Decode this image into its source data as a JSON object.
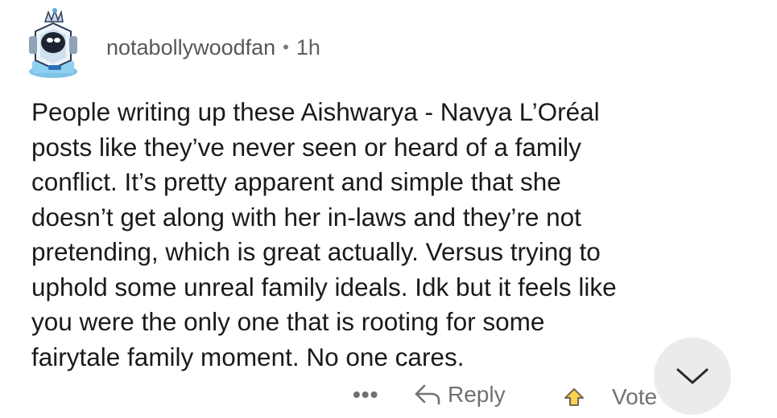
{
  "comment": {
    "username": "notabollywoodfan",
    "separator": "•",
    "timestamp": "1h",
    "body": "People writing up these Aishwarya - Navya L’Oréal\nposts like they’ve never seen or heard of a family\nconflict. It’s pretty apparent and simple that she\ndoesn’t get along with her in-laws and they’re not\npretending, which is great actually. Versus trying to\nuphold some unreal family ideals. Idk but it feels like\nyou were the only one that is rooting for some\nfairytale family moment. No one cares."
  },
  "actions": {
    "more_label": "•••",
    "reply_label": "Reply",
    "vote_label": "Vote"
  },
  "icons": {
    "avatar": "snoo-avatar-icon",
    "reply": "reply-arrow-icon",
    "upvote": "upvote-icon",
    "scroll_down": "chevron-down-icon"
  },
  "colors": {
    "text": "#1a1a1b",
    "meta": "#5f6265",
    "upvote_fill": "#ffd24d",
    "scroll_button_bg": "#e8e9ea"
  }
}
